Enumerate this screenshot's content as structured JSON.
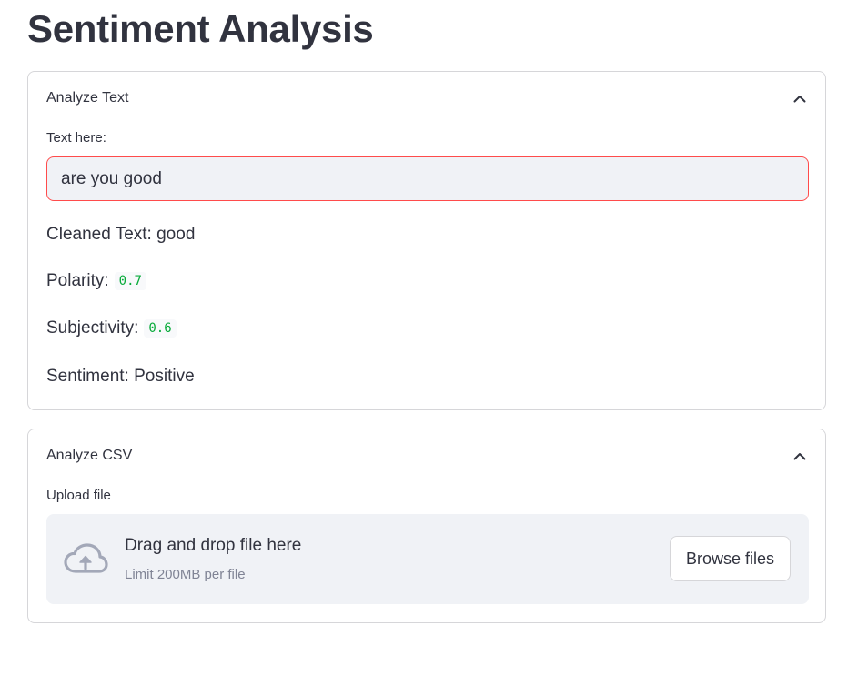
{
  "page": {
    "title": "Sentiment Analysis"
  },
  "analyze_text": {
    "header_label": "Analyze Text",
    "chevron_icon": "chevron-up-icon",
    "input_label": "Text here:",
    "input_value": "are you good",
    "cleaned_text": "Cleaned Text: good",
    "polarity_label": "Polarity:",
    "polarity_value": "0.7",
    "subjectivity_label": "Subjectivity:",
    "subjectivity_value": "0.6",
    "sentiment": "Sentiment: Positive"
  },
  "analyze_csv": {
    "header_label": "Analyze CSV",
    "chevron_icon": "chevron-up-icon",
    "upload_label": "Upload file",
    "dropzone_title": "Drag and drop file here",
    "dropzone_limit": "Limit 200MB per file",
    "upload_icon": "cloud-upload-icon",
    "browse_button": "Browse files"
  },
  "colors": {
    "text": "#31333f",
    "input_border_focus": "#ff4b4b",
    "code_text": "#09ab3b",
    "secondary_text": "#808495",
    "input_background": "#f0f2f6",
    "border": "#d6d6d9"
  }
}
